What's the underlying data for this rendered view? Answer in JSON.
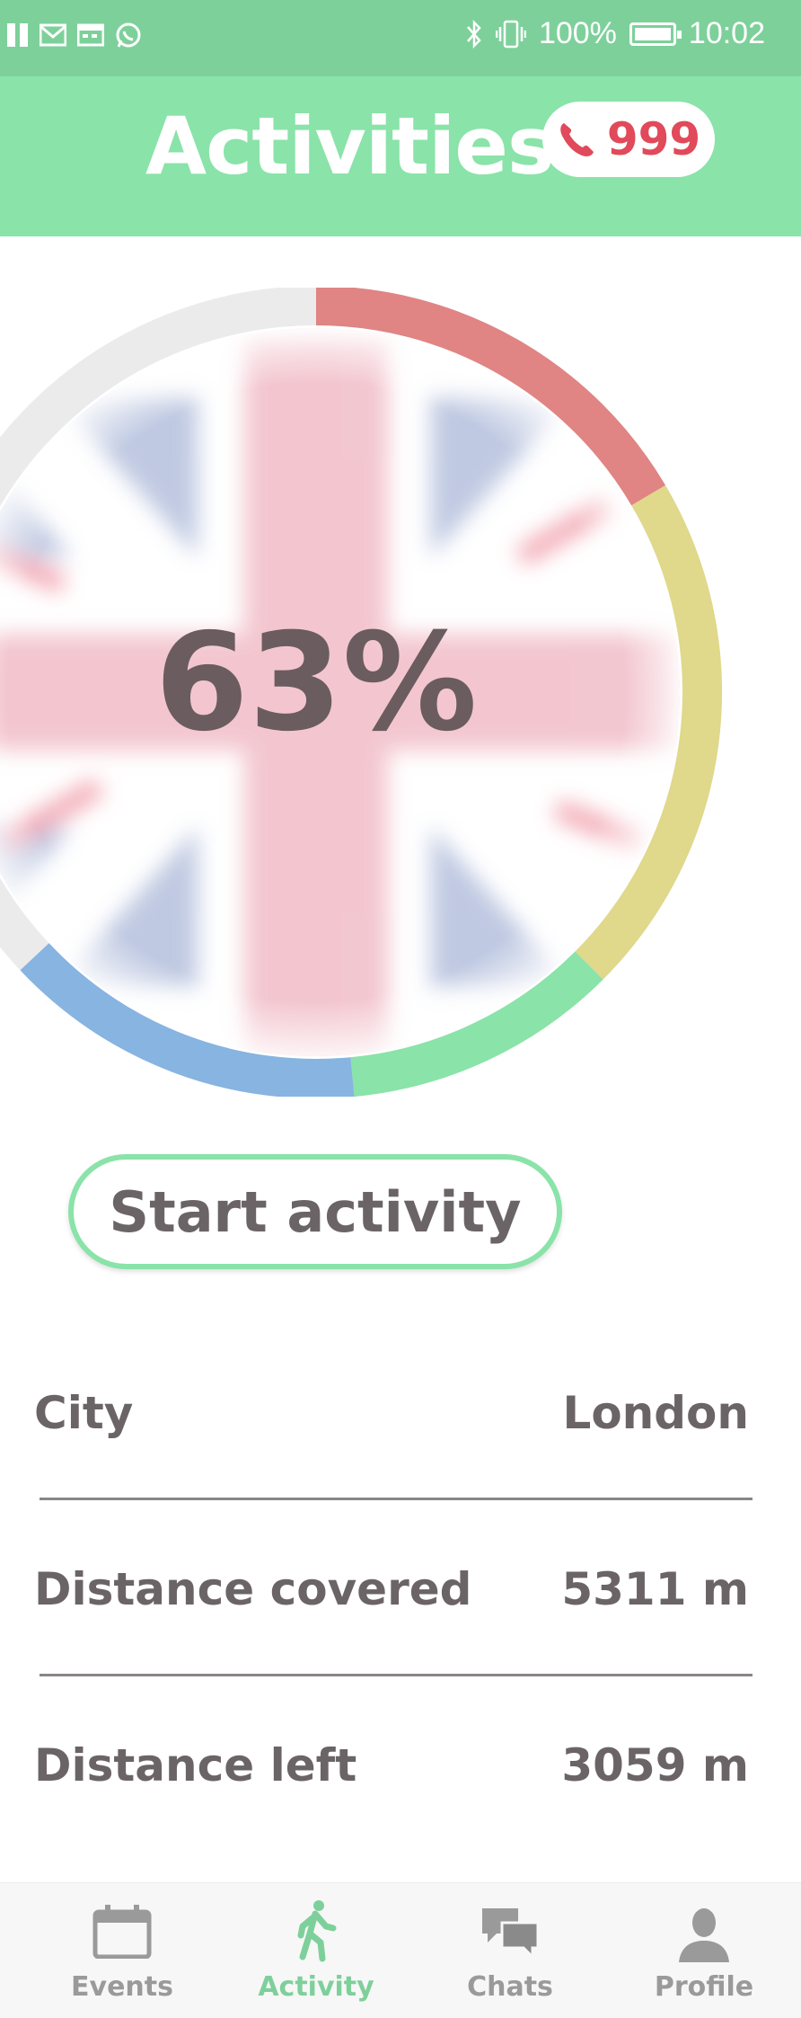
{
  "status_bar": {
    "battery": "100%",
    "time": "10:02"
  },
  "header": {
    "title": "Activities",
    "emergency_number": "999"
  },
  "progress": {
    "percent_label": "63%",
    "value": 0.63,
    "background_image": "union-jack-flag"
  },
  "start_button": {
    "label": "Start activity"
  },
  "stats": [
    {
      "label": "City",
      "value": "London"
    },
    {
      "label": "Distance covered",
      "value": "5311 m"
    },
    {
      "label": "Distance left",
      "value": "3059 m"
    }
  ],
  "nav": {
    "items": [
      {
        "label": "Events",
        "icon": "calendar-icon"
      },
      {
        "label": "Activity",
        "icon": "walking-icon",
        "active": true
      },
      {
        "label": "Chats",
        "icon": "chat-bubbles-icon"
      },
      {
        "label": "Profile",
        "icon": "person-icon"
      }
    ]
  },
  "colors": {
    "accent": "#8ae3a9",
    "status_bar": "#7ed09b",
    "ring_red": "#e08484",
    "ring_yellow": "#e0d88a",
    "ring_green": "#8ae3a9",
    "ring_blue": "#87b4e0",
    "ring_track": "#ebebeb"
  }
}
